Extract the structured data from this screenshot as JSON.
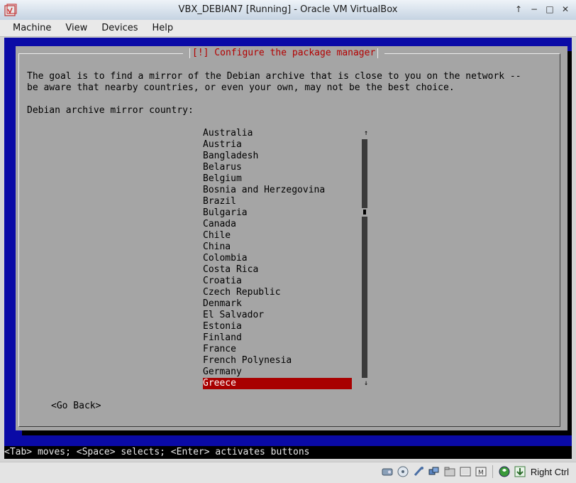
{
  "window": {
    "title": "VBX_DEBIAN7 [Running] - Oracle VM VirtualBox",
    "controls": [
      "↑",
      "−",
      "□",
      "✕"
    ]
  },
  "menubar": {
    "items": [
      "Machine",
      "View",
      "Devices",
      "Help"
    ]
  },
  "installer": {
    "dialog_title": "[!] Configure the package manager",
    "description_line1": "The goal is to find a mirror of the Debian archive that is close to you on the network --",
    "description_line2": "be aware that nearby countries, or even your own, may not be the best choice.",
    "prompt": "Debian archive mirror country:",
    "countries": [
      "Australia",
      "Austria",
      "Bangladesh",
      "Belarus",
      "Belgium",
      "Bosnia and Herzegovina",
      "Brazil",
      "Bulgaria",
      "Canada",
      "Chile",
      "China",
      "Colombia",
      "Costa Rica",
      "Croatia",
      "Czech Republic",
      "Denmark",
      "El Salvador",
      "Estonia",
      "Finland",
      "France",
      "French Polynesia",
      "Germany",
      "Greece"
    ],
    "selected_country": "Greece",
    "scroll_up": "↑",
    "scroll_down": "↓",
    "go_back": "<Go Back>",
    "hint": "<Tab> moves; <Space> selects; <Enter> activates buttons"
  },
  "statusbar": {
    "host_key": "Right Ctrl",
    "icons": [
      "hard-disk-icon",
      "optical-drive-icon",
      "usb-icon",
      "network-icon",
      "shared-folder-icon",
      "display-icon",
      "video-capture-icon",
      "virtualization-icon",
      "mouse-integration-icon"
    ]
  },
  "colors": {
    "installer_background": "#0a0aa6",
    "dialog_background": "#a5a5a5",
    "title_red": "#b30000",
    "selection_red": "#a80000"
  }
}
